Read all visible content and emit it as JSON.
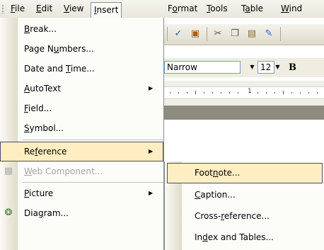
{
  "menubar": {
    "items": [
      {
        "label": "File"
      },
      {
        "label": "Edit"
      },
      {
        "label": "View"
      },
      {
        "label": "Insert"
      },
      {
        "label": "Format"
      },
      {
        "label": "Tools"
      },
      {
        "label": "Table"
      },
      {
        "label": "Wind"
      }
    ]
  },
  "toolbar": {
    "font_name": "Narrow",
    "font_size": "12",
    "bold_label": "B",
    "ruler_mark": "1",
    "icons": [
      "spelling-icon",
      "research-icon",
      "cut-icon",
      "copy-icon",
      "paste-icon",
      "format-painter-icon"
    ]
  },
  "insert_menu": {
    "items": [
      {
        "label": "Break..."
      },
      {
        "label": "Page Numbers..."
      },
      {
        "label": "Date and Time..."
      },
      {
        "label": "AutoText"
      },
      {
        "label": "Field..."
      },
      {
        "label": "Symbol..."
      },
      {
        "label": "Reference"
      },
      {
        "label": "Web Component..."
      },
      {
        "label": "Picture"
      },
      {
        "label": "Diagram..."
      }
    ],
    "highlighted": "Reference"
  },
  "reference_submenu": {
    "items": [
      {
        "label": "Footnote..."
      },
      {
        "label": "Caption..."
      },
      {
        "label": "Cross-reference..."
      },
      {
        "label": "Index and Tables..."
      }
    ],
    "highlighted": "Footnote..."
  },
  "colors": {
    "highlight": "#ffeec2",
    "highlight_border": "#4b4b6f",
    "menu_bg": "#fcfcf9",
    "disabled_text": "#a6a6a6"
  }
}
